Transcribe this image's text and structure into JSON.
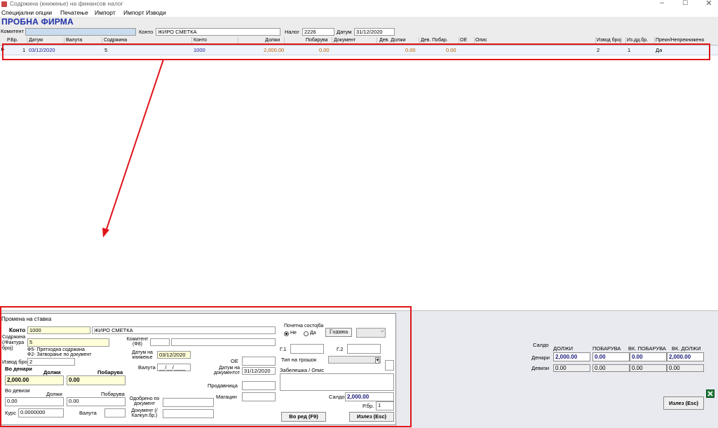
{
  "window": {
    "title": "Содржина (книжење) на финансов налог",
    "minimize": "–",
    "maximize": "☐",
    "close": "✕"
  },
  "menu": [
    "Специјални опции",
    "Печатење",
    "Импорт",
    "Импорт Изводи"
  ],
  "company": "ПРОБНА ФИРМА",
  "filter": {
    "komitent_label": "Комитент",
    "komitent_value": "",
    "konto_label": "Конто",
    "konto_code": "1000",
    "konto_name": "ЖИРО СМЕТКА",
    "nalog_label": "Налог",
    "nalog_value": "2226",
    "datum_label": "Датум",
    "datum_value": "31/12/2020"
  },
  "grid": {
    "columns": [
      "Р.Бр.",
      "Датум",
      "Валута",
      "Содржина",
      "Конто",
      "Должи",
      "Побарува",
      "Документ",
      "Дев. Должи",
      "Дев. Побар.",
      "ОЕ",
      "Опис",
      "Извод број",
      "Из.дд.бр.",
      "Прекн/Непрекнижено"
    ],
    "row": {
      "indicator": "▶",
      "rbr": "1",
      "datum": "03/12/2020",
      "valuta": "",
      "sodrzina": "5",
      "konto": "1000",
      "dolzi": "2,000.00",
      "pobaruva": "0.00",
      "dokument": "",
      "dev_dolzi": "0.00",
      "dev_pobar": "0.00",
      "oe": "",
      "opis": "",
      "izvod_broj": "2",
      "izdd": "1",
      "prekn": "Да"
    }
  },
  "dialog": {
    "title": "Промена на ставка",
    "konto_label": "Конто",
    "konto_code": "1000",
    "konto_name": "ЖИРО СМЕТКА",
    "sodrzina_label": "Содржина (/Фактура број)",
    "sodrzina_value": "5",
    "hint1": "Ф5- Претходна содржина",
    "hint2": "Ф2- Затворање по документ",
    "komitent_label": "Комитент (Ф8)",
    "izvod_label": "Извод број",
    "izvod_value": "2",
    "vo_denari": "Во денари",
    "dolzi_label": "Должи",
    "pobaruva_label": "Побарува",
    "den_dolzi": "2,000.00",
    "den_pobaruva": "0.00",
    "vo_devizi": "Во девизи",
    "dev_dolzi_label": "Должи",
    "dev_pobaruva_label": "Побарува",
    "dev_dolzi": "0.00",
    "dev_pobaruva": "0.00",
    "kurs_label": "Курс",
    "kurs_value": "0.0000000",
    "valuta_label": "Валута",
    "datum_knizenje_label": "Датум на книжење",
    "datum_knizenje": "03/12/2020",
    "valuta_date_label": "Валута",
    "valuta_date": "__/__/____",
    "oe_label": "ОЕ",
    "datum_dok_label": "Датум на документот",
    "datum_dok": "31/12/2020",
    "prodavnica_label": "Продавница",
    "magacin_label": "Магацин",
    "odobreno_label": "Одобрено по документ",
    "dokument_label": "Документ (/Калкул.бр.)",
    "pocetna_label": "Почетна состојба",
    "radio_ne": "Не",
    "radio_da": "Да",
    "godina_btn": "Година",
    "g1_label": "Г.1",
    "g2_label": "Г.2",
    "tip_label": "Тип на трошок",
    "zabeleska_label": "Забелешка / Опис",
    "saldo_label": "Салдо",
    "saldo_value": "2,000.00",
    "rbr_label": "Р.бр.",
    "rbr_value": "1",
    "vo_red_btn": "Во ред (F9)",
    "izlez_btn": "Излез (Esc)"
  },
  "saldo_panel": {
    "title": "Салдо",
    "headers": [
      "ДОЛЖИ",
      "ПОБАРУВА",
      "ВК. ПОБАРУВА",
      "ВК. ДОЛЖИ"
    ],
    "denari_label": "Денари",
    "devizi_label": "Девизи",
    "denari": [
      "2,000.00",
      "0.00",
      "0.00",
      "2,000.00"
    ],
    "devizi": [
      "0.00",
      "0.00",
      "0.00",
      "0.00"
    ]
  },
  "exit_button": "Излез (Esc)",
  "colors": {
    "company": "#1e2fa6",
    "highlight": "#e0141a",
    "amount": "#c06000"
  }
}
